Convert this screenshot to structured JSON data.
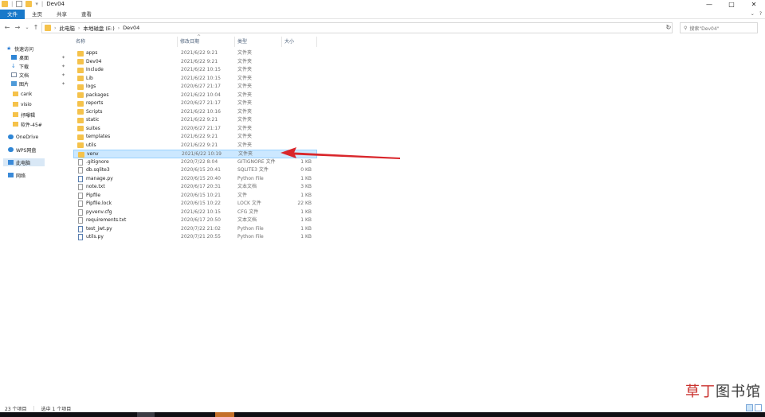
{
  "window": {
    "title": "Dev04",
    "controls": [
      "—",
      "□",
      "✕"
    ]
  },
  "ribbon": {
    "tabs": [
      "文件",
      "主页",
      "共享",
      "查看"
    ],
    "active_tab": "文件",
    "accent": "#1979ca"
  },
  "address": {
    "crumbs": [
      "此电脑",
      "本地磁盘 (E:)",
      "Dev04"
    ],
    "search_placeholder": "搜索\"Dev04\""
  },
  "sidebar": {
    "items": [
      {
        "label": "快速访问",
        "icon": "star-icon",
        "pinned": false
      },
      {
        "label": "桌面",
        "icon": "desktop-icon",
        "pinned": true
      },
      {
        "label": "下载",
        "icon": "download-icon",
        "pinned": true
      },
      {
        "label": "文档",
        "icon": "document-icon",
        "pinned": true
      },
      {
        "label": "图片",
        "icon": "picture-icon",
        "pinned": true
      },
      {
        "label": "cank",
        "icon": "folder-icon",
        "pinned": false
      },
      {
        "label": "visio",
        "icon": "folder-icon",
        "pinned": false
      },
      {
        "label": "抒曝辑",
        "icon": "folder-icon",
        "pinned": false
      },
      {
        "label": "软件-45#",
        "icon": "folder-icon",
        "pinned": false
      },
      {
        "label": "OneDrive",
        "icon": "cloud-icon",
        "pinned": false
      },
      {
        "label": "WPS网盘",
        "icon": "cloud-icon",
        "pinned": false
      },
      {
        "label": "此电脑",
        "icon": "computer-icon",
        "pinned": false
      },
      {
        "label": "网络",
        "icon": "network-icon",
        "pinned": false
      }
    ],
    "active": "此电脑"
  },
  "columns": [
    "名称",
    "修改日期",
    "类型",
    "大小"
  ],
  "files": [
    {
      "name": "apps",
      "date": "2021/6/22 9:21",
      "type": "文件夹",
      "size": "",
      "kind": "folder"
    },
    {
      "name": "Dev04",
      "date": "2021/6/22 9:21",
      "type": "文件夹",
      "size": "",
      "kind": "folder"
    },
    {
      "name": "Include",
      "date": "2021/6/22 10:15",
      "type": "文件夹",
      "size": "",
      "kind": "folder"
    },
    {
      "name": "Lib",
      "date": "2021/6/22 10:15",
      "type": "文件夹",
      "size": "",
      "kind": "folder"
    },
    {
      "name": "logs",
      "date": "2020/6/27 21:17",
      "type": "文件夹",
      "size": "",
      "kind": "folder"
    },
    {
      "name": "packages",
      "date": "2021/6/22 10:04",
      "type": "文件夹",
      "size": "",
      "kind": "folder"
    },
    {
      "name": "reports",
      "date": "2020/6/27 21:17",
      "type": "文件夹",
      "size": "",
      "kind": "folder"
    },
    {
      "name": "Scripts",
      "date": "2021/6/22 10:16",
      "type": "文件夹",
      "size": "",
      "kind": "folder"
    },
    {
      "name": "static",
      "date": "2021/6/22 9:21",
      "type": "文件夹",
      "size": "",
      "kind": "folder"
    },
    {
      "name": "suites",
      "date": "2020/6/27 21:17",
      "type": "文件夹",
      "size": "",
      "kind": "folder"
    },
    {
      "name": "templates",
      "date": "2021/6/22 9:21",
      "type": "文件夹",
      "size": "",
      "kind": "folder"
    },
    {
      "name": "utils",
      "date": "2021/6/22 9:21",
      "type": "文件夹",
      "size": "",
      "kind": "folder"
    },
    {
      "name": "venv",
      "date": "2021/6/22 10:19",
      "type": "文件夹",
      "size": "",
      "kind": "folder",
      "selected": true
    },
    {
      "name": ".gitignore",
      "date": "2020/7/22 8:04",
      "type": "GITIGNORE 文件",
      "size": "1 KB",
      "kind": "file"
    },
    {
      "name": "db.sqlite3",
      "date": "2020/6/15 20:41",
      "type": "SQLITE3 文件",
      "size": "0 KB",
      "kind": "file"
    },
    {
      "name": "manage.py",
      "date": "2020/6/15 20:40",
      "type": "Python File",
      "size": "1 KB",
      "kind": "py"
    },
    {
      "name": "note.txt",
      "date": "2020/6/17 20:31",
      "type": "文本文档",
      "size": "3 KB",
      "kind": "file"
    },
    {
      "name": "Pipfile",
      "date": "2020/6/15 10:21",
      "type": "文件",
      "size": "1 KB",
      "kind": "file"
    },
    {
      "name": "Pipfile.lock",
      "date": "2020/6/15 10:22",
      "type": "LOCK 文件",
      "size": "22 KB",
      "kind": "file"
    },
    {
      "name": "pyvenv.cfg",
      "date": "2021/6/22 10:15",
      "type": "CFG 文件",
      "size": "1 KB",
      "kind": "file"
    },
    {
      "name": "requirements.txt",
      "date": "2020/6/17 20:50",
      "type": "文本文档",
      "size": "1 KB",
      "kind": "file"
    },
    {
      "name": "test_jwt.py",
      "date": "2020/7/22 21:02",
      "type": "Python File",
      "size": "1 KB",
      "kind": "py"
    },
    {
      "name": "utils.py",
      "date": "2020/7/21 20:55",
      "type": "Python File",
      "size": "1 KB",
      "kind": "py"
    }
  ],
  "status": {
    "count": "23 个项目",
    "selected": "选中 1 个项目"
  },
  "watermark": {
    "red": "草丁",
    "dark": "图书馆"
  },
  "colors": {
    "selection_bg": "#cce8ff",
    "annotation_arrow": "#d9262b"
  }
}
